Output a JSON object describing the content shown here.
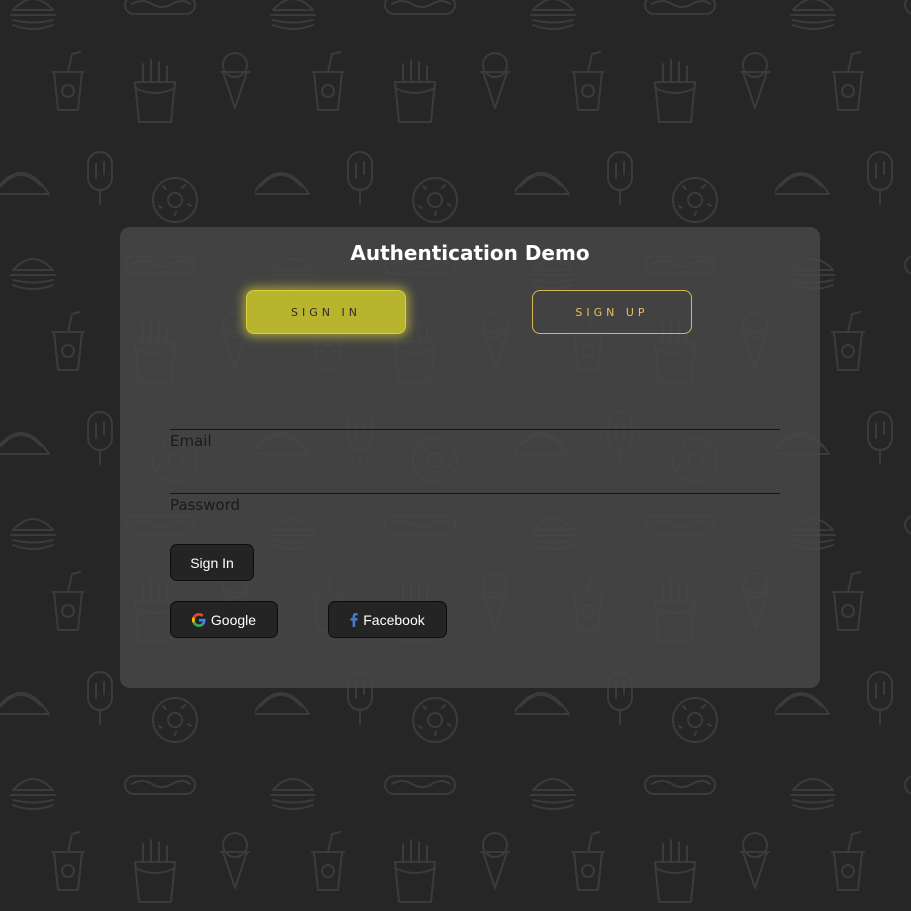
{
  "auth": {
    "title": "Authentication Demo",
    "tabs": {
      "sign_in": "SIGN IN",
      "sign_up": "SIGN UP",
      "active": "sign_in"
    },
    "fields": {
      "email_label": "Email",
      "password_label": "Password"
    },
    "submit_label": "Sign In",
    "social": {
      "google_label": "Google",
      "google_icon": "google-g-icon",
      "facebook_label": "Facebook",
      "facebook_icon": "facebook-f-icon"
    }
  },
  "background": {
    "pattern_icons": [
      "burger-icon",
      "hotdog-icon",
      "soda-cup-icon",
      "ice-cream-cone-icon",
      "fries-icon",
      "taco-icon",
      "popsicle-icon",
      "donut-icon"
    ]
  },
  "colors": {
    "page_bg": "#262626",
    "card_bg": "#484848",
    "accent_yellow": "#b8b42e",
    "signup_gold": "#d9b655"
  }
}
